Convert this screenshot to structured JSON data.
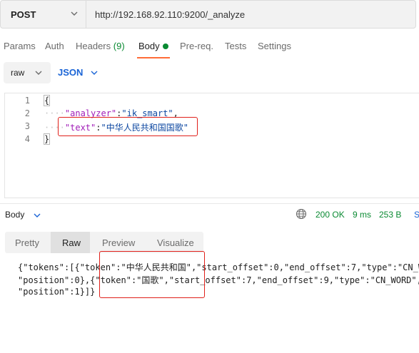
{
  "request": {
    "method": "POST",
    "url": "http://192.168.92.110:9200/_analyze"
  },
  "tabs": [
    {
      "label": "Params"
    },
    {
      "label": "Auth"
    },
    {
      "label": "Headers",
      "count": "(9)"
    },
    {
      "label": "Body"
    },
    {
      "label": "Pre-req."
    },
    {
      "label": "Tests"
    },
    {
      "label": "Settings"
    }
  ],
  "body_options": {
    "mode": "raw",
    "language": "JSON"
  },
  "editor": {
    "line_numbers": [
      "1",
      "2",
      "3",
      "4"
    ],
    "open_brace": "{",
    "line2_key": "\"analyzer\"",
    "line2_value": "\"ik_smart\"",
    "line3_key": "\"text\"",
    "line3_value": "\"中华人民共和国国歌\"",
    "close_brace": "}"
  },
  "response": {
    "section_label": "Body",
    "status": "200 OK",
    "time": "9 ms",
    "size": "253 B",
    "save_label": "S",
    "view_tabs": [
      "Pretty",
      "Raw",
      "Preview",
      "Visualize"
    ],
    "lines": [
      "{\"tokens\":[{\"token\":\"中华人民共和国\",\"start_offset\":0,\"end_offset\":7,\"type\":\"CN_W",
      "\"position\":0},{\"token\":\"国歌\",\"start_offset\":7,\"end_offset\":9,\"type\":\"CN_WORD\",",
      "\"position\":1}]}"
    ]
  },
  "colors": {
    "accent_orange": "#ff6c37",
    "success_green": "#0a8a32",
    "link_blue": "#1a64d6",
    "highlight_red": "#e0201a"
  }
}
